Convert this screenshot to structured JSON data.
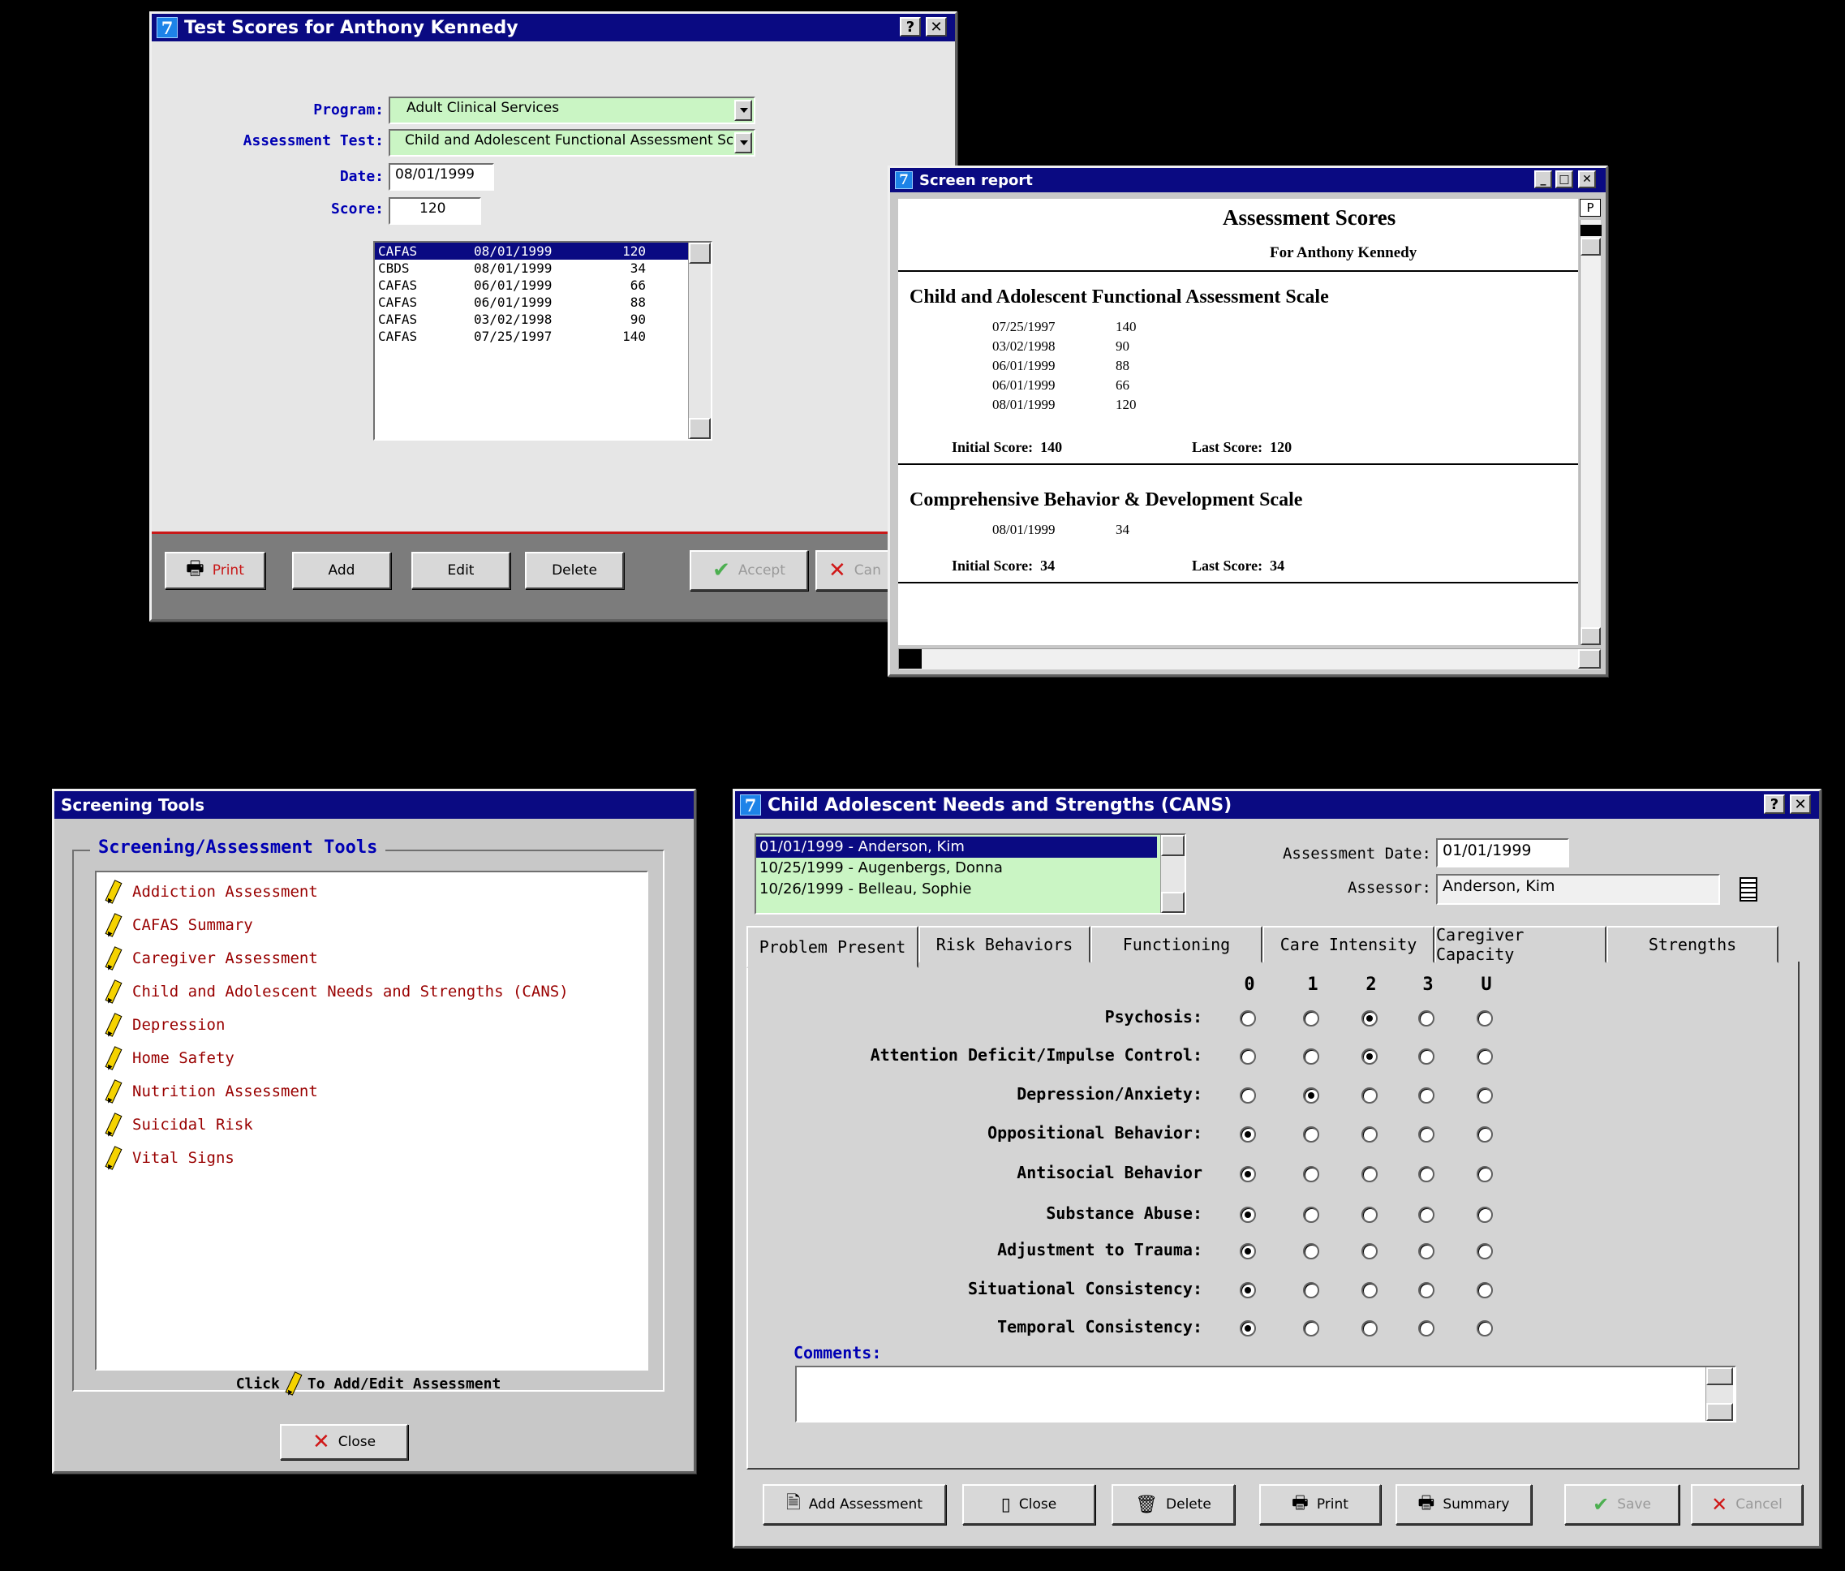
{
  "test_scores": {
    "title": "Test Scores for Anthony Kennedy",
    "help": "?",
    "close": "✕",
    "program_label": "Program:",
    "program_value": "Adult Clinical Services",
    "test_label": "Assessment Test:",
    "test_value": "Child and Adolescent Functional Assessment Sc",
    "date_label": "Date:",
    "date_value": "08/01/1999",
    "score_label": "Score:",
    "score_value": "120",
    "rows": [
      {
        "code": "CAFAS",
        "date": "08/01/1999",
        "score": "120"
      },
      {
        "code": "CBDS",
        "date": "08/01/1999",
        "score": "34"
      },
      {
        "code": "CAFAS",
        "date": "06/01/1999",
        "score": "66"
      },
      {
        "code": "CAFAS",
        "date": "06/01/1999",
        "score": "88"
      },
      {
        "code": "CAFAS",
        "date": "03/02/1998",
        "score": "90"
      },
      {
        "code": "CAFAS",
        "date": "07/25/1997",
        "score": "140"
      }
    ],
    "btn_print": "Print",
    "btn_add": "Add",
    "btn_edit": "Edit",
    "btn_delete": "Delete",
    "btn_accept": "Accept",
    "btn_cancel": "Can"
  },
  "report": {
    "title": "Screen report",
    "p_marker": "P",
    "heading": "Assessment Scores",
    "subheading": "For Anthony Kennedy",
    "sections": [
      {
        "name": "Child and Adolescent Functional Assessment Scale",
        "entries": [
          {
            "date": "07/25/1997",
            "score": "140"
          },
          {
            "date": "03/02/1998",
            "score": "90"
          },
          {
            "date": "06/01/1999",
            "score": "88"
          },
          {
            "date": "06/01/1999",
            "score": "66"
          },
          {
            "date": "08/01/1999",
            "score": "120"
          }
        ],
        "initial": "Initial Score:  140",
        "last": "Last Score:  120"
      },
      {
        "name": "Comprehensive Behavior & Development Scale",
        "entries": [
          {
            "date": "08/01/1999",
            "score": "34"
          }
        ],
        "initial": "Initial Score:  34",
        "last": "Last Score:  34"
      }
    ]
  },
  "screening": {
    "title": "Screening Tools",
    "group_label": "Screening/Assessment Tools",
    "items": [
      "Addiction Assessment",
      "CAFAS Summary",
      "Caregiver Assessment",
      "Child and Adolescent Needs and Strengths (CANS)",
      "Depression",
      "Home Safety",
      "Nutrition Assessment",
      "Suicidal Risk",
      "Vital Signs"
    ],
    "hint_click": "Click",
    "hint_rest": "To Add/Edit Assessment",
    "close_label": "Close"
  },
  "cans": {
    "title": "Child Adolescent Needs and Strengths (CANS)",
    "help": "?",
    "close": "✕",
    "assessments": [
      "01/01/1999 - Anderson, Kim",
      "10/25/1999 - Augenbergs, Donna",
      "10/26/1999 - Belleau, Sophie"
    ],
    "date_label": "Assessment Date:",
    "date_value": "01/01/1999",
    "assessor_label": "Assessor:",
    "assessor_value": "Anderson, Kim",
    "tabs": [
      "Problem Present",
      "Risk Behaviors",
      "Functioning",
      "Care Intensity",
      "Caregiver Capacity",
      "Strengths"
    ],
    "columns": [
      "0",
      "1",
      "2",
      "3",
      "U"
    ],
    "items": [
      {
        "label": "Psychosis:",
        "selected": 2
      },
      {
        "label": "Attention Deficit/Impulse Control:",
        "selected": 2
      },
      {
        "label": "Depression/Anxiety:",
        "selected": 1
      },
      {
        "label": "Oppositional Behavior:",
        "selected": 0
      },
      {
        "label": "Antisocial Behavior",
        "selected": 0
      },
      {
        "label": "Substance Abuse:",
        "selected": 0
      },
      {
        "label": "Adjustment to Trauma:",
        "selected": 0
      },
      {
        "label": "Situational Consistency:",
        "selected": 0
      },
      {
        "label": "Temporal Consistency:",
        "selected": 0
      }
    ],
    "comments_label": "Comments:",
    "comments_value": "",
    "btn_add": "Add Assessment",
    "btn_close": "Close",
    "btn_delete": "Delete",
    "btn_print": "Print",
    "btn_summary": "Summary",
    "btn_save": "Save",
    "btn_cancel": "Cancel"
  },
  "colors": {
    "title_bar": "#0a0a82",
    "field_green": "#caf5c4",
    "window_bg": "#d4d4d4",
    "item_text": "#990000",
    "label_blue": "#0000b4"
  }
}
